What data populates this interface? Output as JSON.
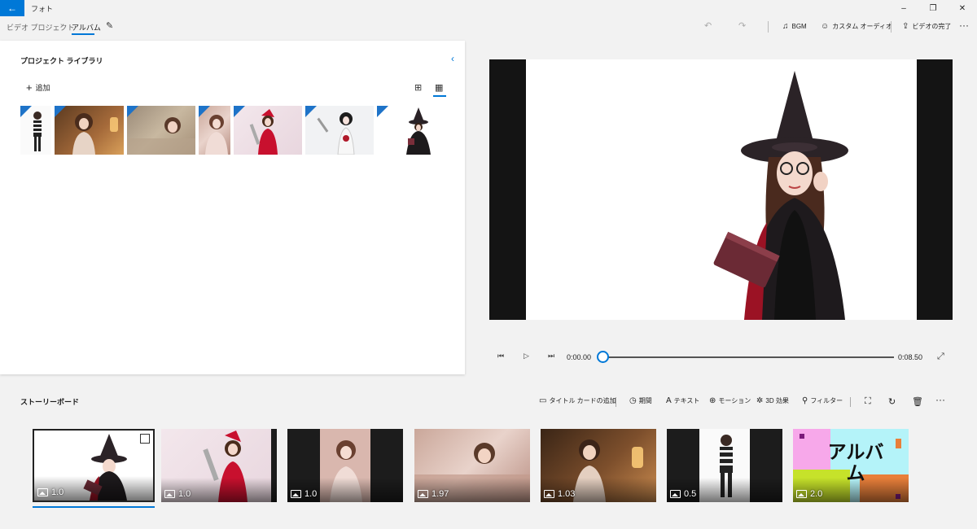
{
  "window": {
    "back_glyph": "←",
    "app_title": "フォト",
    "minimize_glyph": "–",
    "restore_glyph": "❐",
    "close_glyph": "✕"
  },
  "breadcrumb": {
    "parent": "ビデオ プロジェクト",
    "separator": "›",
    "current": "アルバム"
  },
  "toolbar": {
    "undo_icon": "undo-icon",
    "redo_icon": "redo-icon",
    "bgm_label": "BGM",
    "custom_audio_label": "カスタム オーディオ",
    "finish_label": "ビデオの完了",
    "more_glyph": "···"
  },
  "library": {
    "title": "プロジェクト ライブラリ",
    "add_label": "追加",
    "collapse_glyph": "‹"
  },
  "player": {
    "current_time": "0:00.00",
    "total_time": "0:08.50",
    "progress": 0.0
  },
  "storyboard": {
    "title": "ストーリーボード",
    "tools": {
      "title_card": "タイトル カードの追加",
      "duration": "期間",
      "text": "テキスト",
      "motion": "モーション",
      "effects_3d": "3D 効果",
      "filter": "フィルター"
    },
    "clips": [
      {
        "duration": "1.0",
        "selected": true
      },
      {
        "duration": "1.0",
        "selected": false
      },
      {
        "duration": "1.0",
        "selected": false
      },
      {
        "duration": "1.97",
        "selected": false
      },
      {
        "duration": "1.03",
        "selected": false
      },
      {
        "duration": "0.5",
        "selected": false
      },
      {
        "duration": "2.0",
        "selected": false,
        "title_card_text": "アルバム"
      }
    ]
  },
  "colors": {
    "accent": "#0078d7",
    "title_card_bg": "#b4f3f9"
  }
}
